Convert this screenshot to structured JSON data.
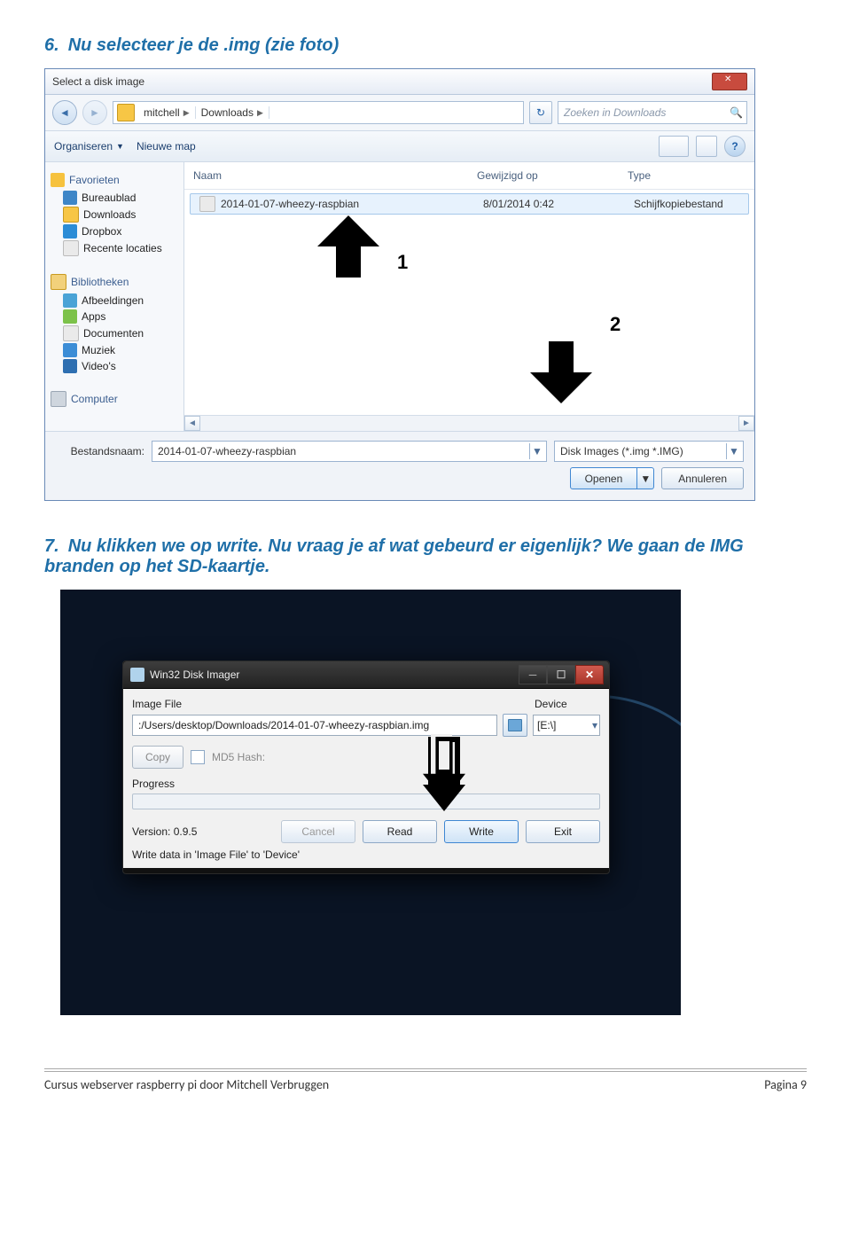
{
  "step6": {
    "num": "6.",
    "text": "Nu selecteer je de .img (zie foto)"
  },
  "step7": {
    "num": "7.",
    "text": "Nu klikken we op write. Nu vraag je af wat gebeurd er eigenlijk? We gaan de IMG branden op het SD-kaartje."
  },
  "dlg1": {
    "title": "Select a disk image",
    "breadcrumb": [
      "mitchell",
      "Downloads"
    ],
    "search_placeholder": "Zoeken in Downloads",
    "toolbar": {
      "organize": "Organiseren",
      "newfolder": "Nieuwe map"
    },
    "sidebar": {
      "favorites": "Favorieten",
      "items_fav": [
        "Bureaublad",
        "Downloads",
        "Dropbox",
        "Recente locaties"
      ],
      "libraries": "Bibliotheken",
      "items_lib": [
        "Afbeeldingen",
        "Apps",
        "Documenten",
        "Muziek",
        "Video's"
      ],
      "computer": "Computer"
    },
    "columns": {
      "name": "Naam",
      "modified": "Gewijzigd op",
      "type": "Type"
    },
    "row": {
      "name": "2014-01-07-wheezy-raspbian",
      "modified": "8/01/2014 0:42",
      "type": "Schijfkopiebestand"
    },
    "filename_label": "Bestandsnaam:",
    "filename_value": "2014-01-07-wheezy-raspbian",
    "filter": "Disk Images (*.img *.IMG)",
    "open": "Openen",
    "cancel": "Annuleren",
    "ann1": "1",
    "ann2": "2"
  },
  "win2": {
    "title": "Win32 Disk Imager",
    "label_image": "Image File",
    "label_device": "Device",
    "path": ":/Users/desktop/Downloads/2014-01-07-wheezy-raspbian.img",
    "device": "[E:\\]",
    "copy": "Copy",
    "md5": "MD5 Hash:",
    "progress": "Progress",
    "version": "Version: 0.9.5",
    "btn_cancel": "Cancel",
    "btn_read": "Read",
    "btn_write": "Write",
    "btn_exit": "Exit",
    "status": "Write data in 'Image File' to 'Device'"
  },
  "footer": {
    "left": "Cursus webserver raspberry pi  door Mitchell Verbruggen",
    "right": "Pagina 9"
  }
}
